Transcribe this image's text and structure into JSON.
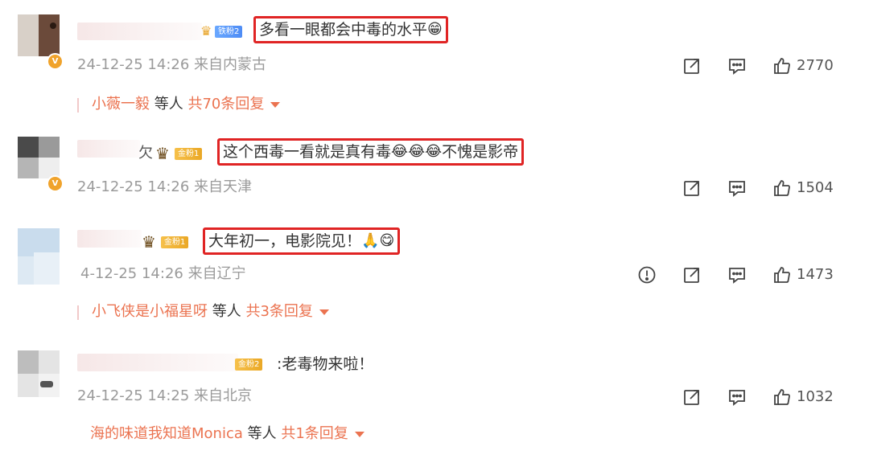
{
  "comments": [
    {
      "fan_badge": "铁粉2",
      "text": "多看一眼都会中毒的水平",
      "emojis": [
        "😁"
      ],
      "meta": "24-12-25 14:26 来自内蒙古",
      "likes": "2770",
      "verified": true,
      "reply_users": "小薇一毅",
      "reply_etc": " 等人 ",
      "reply_count": "共70条回复"
    },
    {
      "name_fragment": "欠",
      "fan_badge": "金粉1",
      "text": "这个西毒一看就是真有毒",
      "emojis": [
        "😂",
        "😂",
        "😂"
      ],
      "text_tail": "不愧是影帝",
      "meta": "24-12-25 14:26 来自天津",
      "likes": "1504",
      "verified": true
    },
    {
      "fan_badge": "金粉1",
      "text": "大年初一，电影院见！",
      "emojis": [
        "🙏",
        "😋"
      ],
      "meta": "4-12-25 14:26 来自辽宁",
      "likes": "1473",
      "reply_users": "小飞侠是小福星呀",
      "reply_etc": " 等人 ",
      "reply_count": "共3条回复"
    },
    {
      "fan_badge": "金粉2",
      "text": ":老毒物来啦！",
      "meta": "24-12-25 14:25 来自北京",
      "likes": "1032",
      "reply_users": "海的味道我知道Monica",
      "reply_etc": " 等人 ",
      "reply_count": "共1条回复"
    }
  ],
  "icons": [
    "share-icon",
    "comment-icon",
    "like-icon",
    "report-icon",
    "verified-icon",
    "crown-icon"
  ],
  "colors": {
    "highlight_box": "#e02424",
    "reply_link": "#eb7350",
    "meta_text": "#9a9a9a",
    "fan_blue": "#4e8cf5",
    "fan_gold": "#eaa826"
  }
}
